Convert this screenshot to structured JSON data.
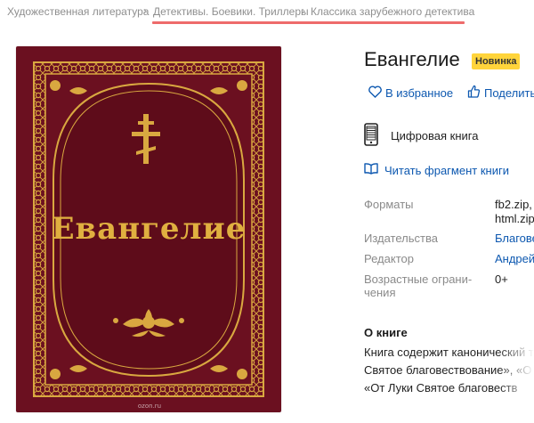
{
  "breadcrumb": {
    "items": [
      "Художественная литература",
      "Детективы. Боевики. Триллеры",
      "Классика зарубежного детектива"
    ],
    "separator": "›",
    "highlight_color": "#ee6b6b"
  },
  "book": {
    "title": "Евангелие",
    "badge": "Новинка",
    "cover_title": "Евангелие",
    "cover_watermark": "ozon.ru",
    "cover_colors": {
      "background": "#6b1020",
      "ornament": "#d9a840"
    }
  },
  "actions": {
    "favorite": "В избранное",
    "share": "Поделиться"
  },
  "format_type": "Цифровая книга",
  "read_fragment": "Читать фрагмент книги",
  "specs": [
    {
      "label_lines": [
        "Форматы"
      ],
      "value_lines": [
        "fb2.zip,",
        "html.zip"
      ],
      "link": false
    },
    {
      "label_lines": [
        "Издательства"
      ],
      "value_lines": [
        "Благовест"
      ],
      "link": true
    },
    {
      "label_lines": [
        "Редактор"
      ],
      "value_lines": [
        "Андрей"
      ],
      "link": true
    },
    {
      "label_lines": [
        "Возрастные ограни-",
        "чения"
      ],
      "value_lines": [
        "0+"
      ],
      "link": false
    }
  ],
  "about": {
    "heading": "О книге",
    "lines": [
      "Книга содержит канонический т",
      "Святое благовествование», «О",
      "«От Луки Святое благовеств"
    ]
  },
  "colors": {
    "link": "#0d58b0",
    "badge": "#ffd43b"
  }
}
